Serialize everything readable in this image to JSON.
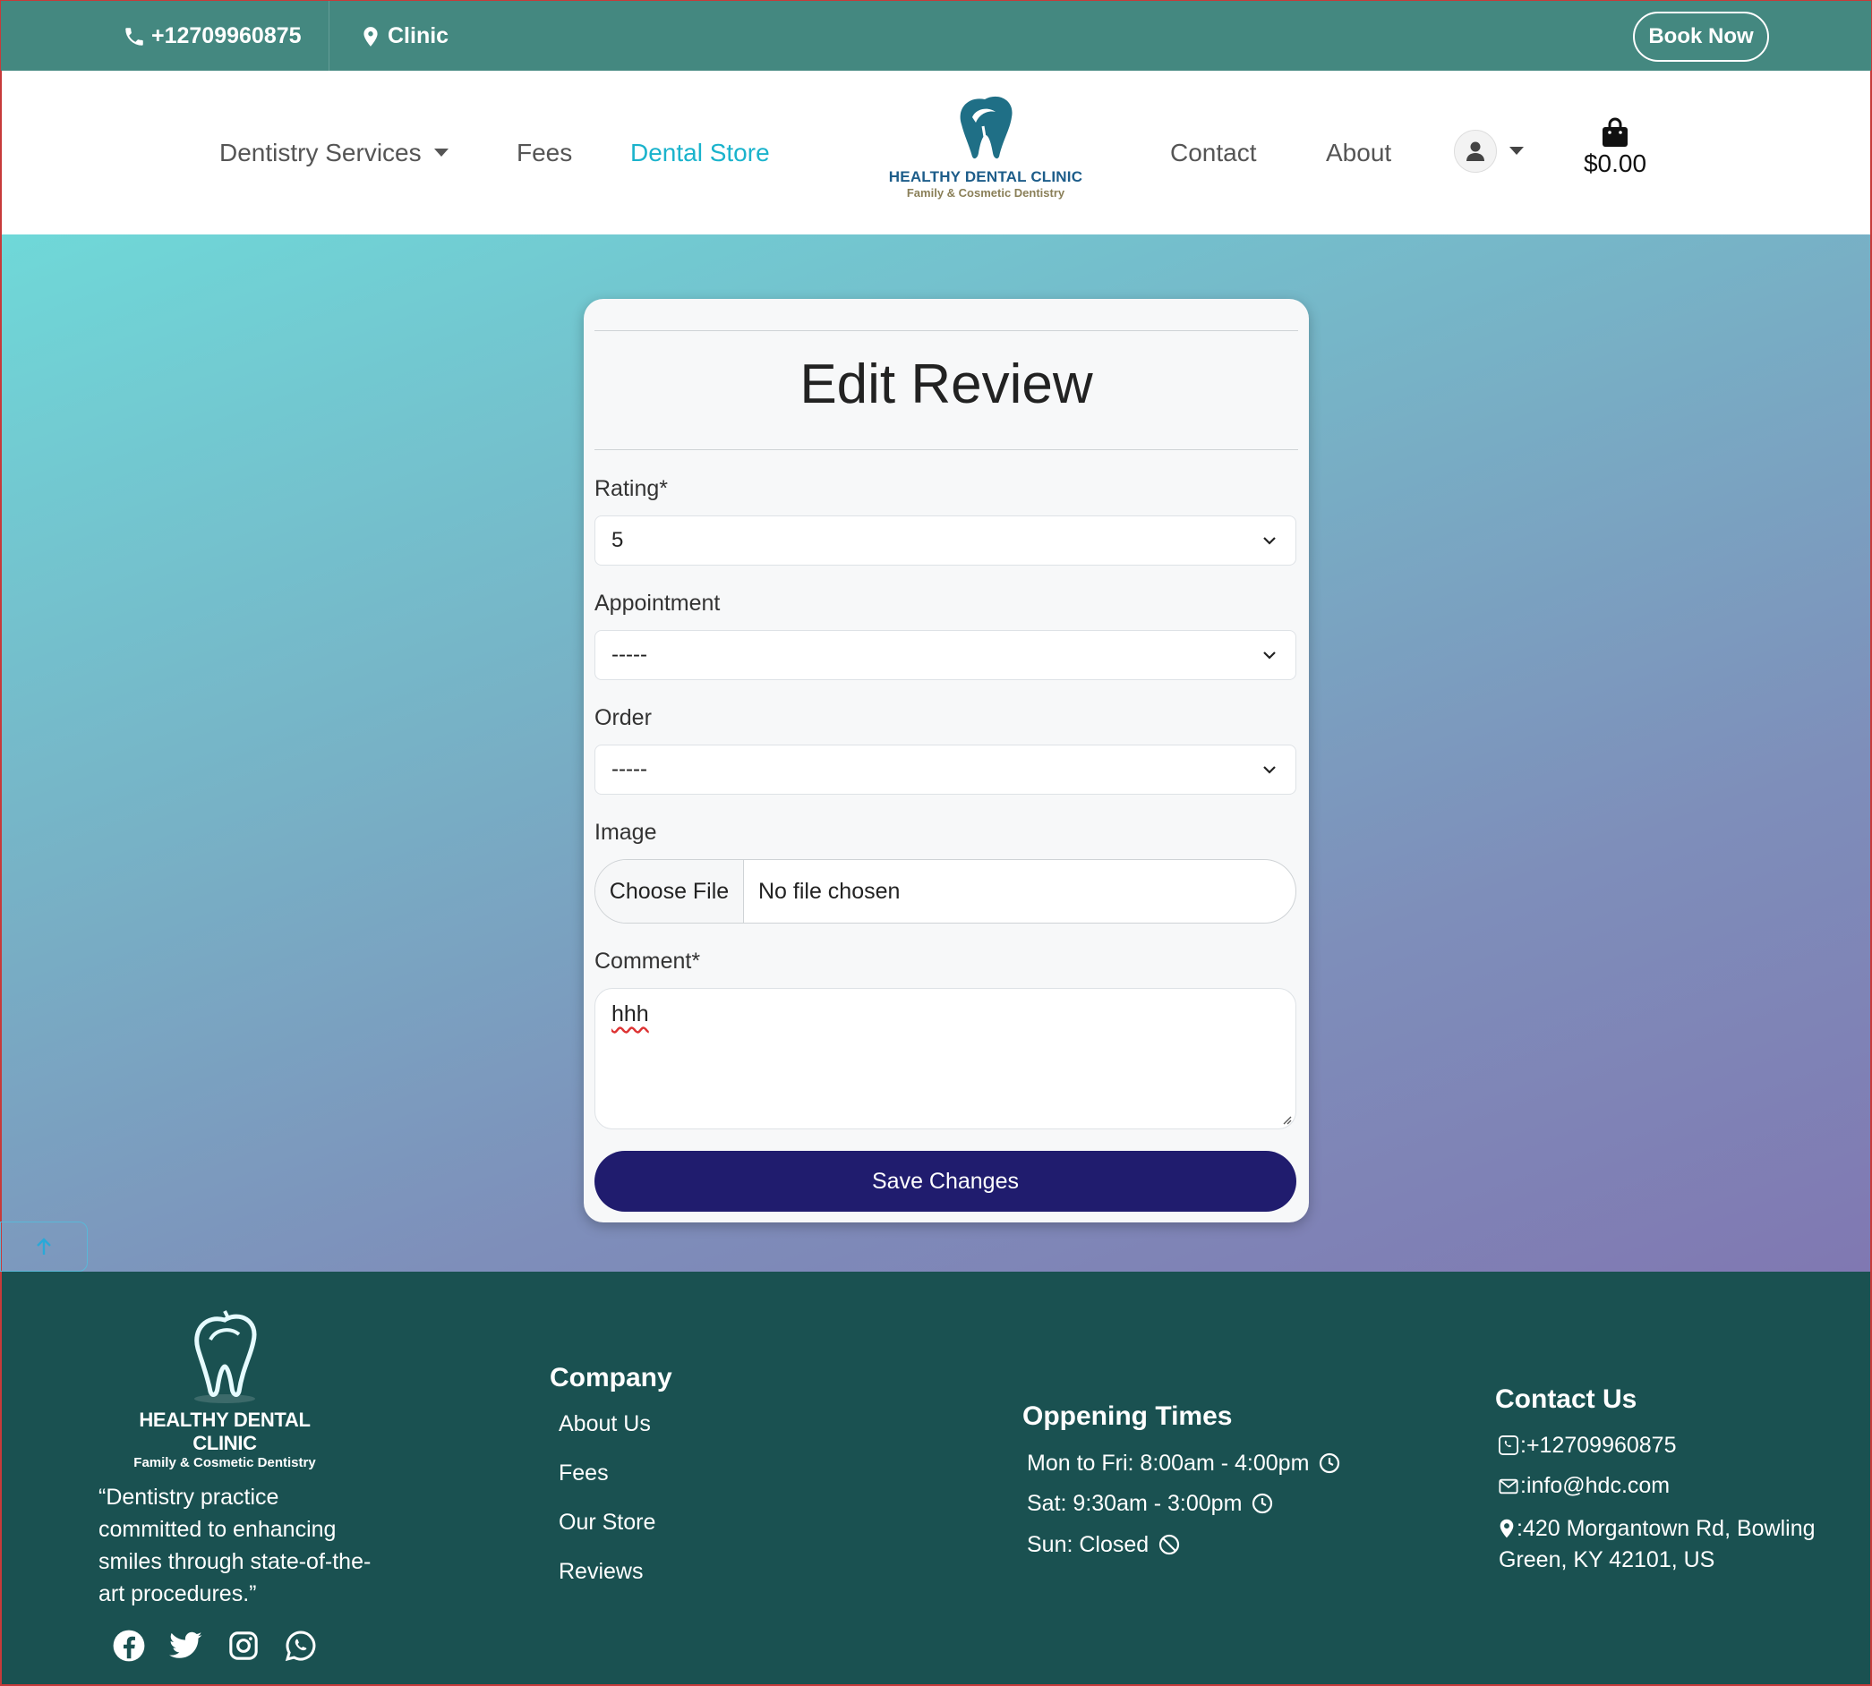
{
  "topbar": {
    "phone": "+12709960875",
    "location": "Clinic",
    "book_label": "Book Now"
  },
  "nav": {
    "services_label": "Dentistry Services",
    "fees_label": "Fees",
    "store_label": "Dental Store",
    "logo_brand": "HEALTHY DENTAL CLINIC",
    "logo_tagline": "Family & Cosmetic Dentistry",
    "contact_label": "Contact",
    "about_label": "About",
    "cart_total": "$0.00"
  },
  "form": {
    "title": "Edit Review",
    "rating_label": "Rating*",
    "rating_value": "5",
    "appointment_label": "Appointment",
    "appointment_value": "-----",
    "order_label": "Order",
    "order_value": "-----",
    "image_label": "Image",
    "choose_file_label": "Choose File",
    "no_file_label": "No file chosen",
    "comment_label": "Comment*",
    "comment_value": "hhh",
    "save_label": "Save Changes"
  },
  "footer": {
    "logo_brand": "HEALTHY DENTAL CLINIC",
    "logo_tagline": "Family & Cosmetic Dentistry",
    "quote": "“Dentistry practice committed to enhancing smiles through state-of-the-art procedures.”",
    "company": {
      "heading": "Company",
      "links": [
        "About Us",
        "Fees",
        "Our Store",
        "Reviews"
      ]
    },
    "hours": {
      "heading": "Oppening Times",
      "weekdays": "Mon to Fri: 8:00am - 4:00pm",
      "saturday": "Sat: 9:30am - 3:00pm",
      "sunday": "Sun: Closed"
    },
    "contact": {
      "heading": "Contact Us",
      "phone": ":+12709960875",
      "email": ":info@hdc.com",
      "address": ":420 Morgantown Rd, Bowling Green, KY 42101, US"
    }
  },
  "colors": {
    "topbar": "#448880",
    "accent": "#1ab3cc",
    "button": "#201c6e",
    "footer": "#1a5151"
  },
  "icons": [
    "phone-icon",
    "map-pin-icon",
    "user-icon",
    "shopping-bag-icon",
    "chevron-down-icon",
    "arrow-up-icon",
    "facebook-icon",
    "twitter-icon",
    "instagram-icon",
    "whatsapp-icon",
    "clock-icon",
    "ban-icon",
    "phone-square-icon",
    "envelope-icon"
  ]
}
